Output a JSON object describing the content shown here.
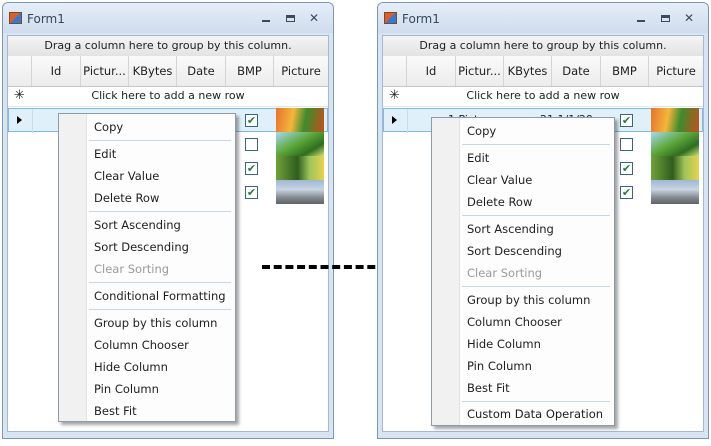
{
  "windows": [
    {
      "title": "Form1",
      "group_panel": "Drag a column here to group by this column.",
      "columns": [
        "Id",
        "Pictur...",
        "KBytes",
        "Date",
        "BMP",
        "Picture"
      ],
      "new_row": "Click here to add a new row",
      "row0_text": "",
      "bmp_checks": [
        "✔",
        "",
        "✔",
        "✔"
      ],
      "menu": [
        {
          "label": "Copy"
        },
        {
          "label": "Edit"
        },
        {
          "label": "Clear Value"
        },
        {
          "label": "Delete Row"
        },
        {
          "label": "Sort Ascending"
        },
        {
          "label": "Sort Descending"
        },
        {
          "label": "Clear Sorting"
        },
        {
          "label": "Conditional Formatting"
        },
        {
          "label": "Group by this column"
        },
        {
          "label": "Column Chooser"
        },
        {
          "label": "Hide Column"
        },
        {
          "label": "Pin Column"
        },
        {
          "label": "Best Fit"
        }
      ]
    },
    {
      "title": "Form1",
      "group_panel": "Drag a column here to group by this column.",
      "columns": [
        "Id",
        "Pictur...",
        "KBytes",
        "Date",
        "BMP",
        "Picture"
      ],
      "new_row": "Click here to add a new row",
      "row0_text": "1 Pictur",
      "row0_date": "21 1/1/20",
      "bmp_checks": [
        "✔",
        "",
        "✔",
        "✔"
      ],
      "menu": [
        {
          "label": "Copy"
        },
        {
          "label": "Edit"
        },
        {
          "label": "Clear Value"
        },
        {
          "label": "Delete Row"
        },
        {
          "label": "Sort Ascending"
        },
        {
          "label": "Sort Descending"
        },
        {
          "label": "Clear Sorting"
        },
        {
          "label": "Group by this column"
        },
        {
          "label": "Column Chooser"
        },
        {
          "label": "Hide Column"
        },
        {
          "label": "Pin Column"
        },
        {
          "label": "Best Fit"
        },
        {
          "label": "Custom Data Operation"
        }
      ]
    }
  ],
  "icons": {
    "arrow": "dashed-right-arrow-icon",
    "new_row": "asterisk-icon",
    "row": "row-indicator-icon"
  },
  "colors": {
    "selection": "#dff0fb",
    "window_frame": "#d7e4f2",
    "menu_separator": "#c7d7e8"
  }
}
